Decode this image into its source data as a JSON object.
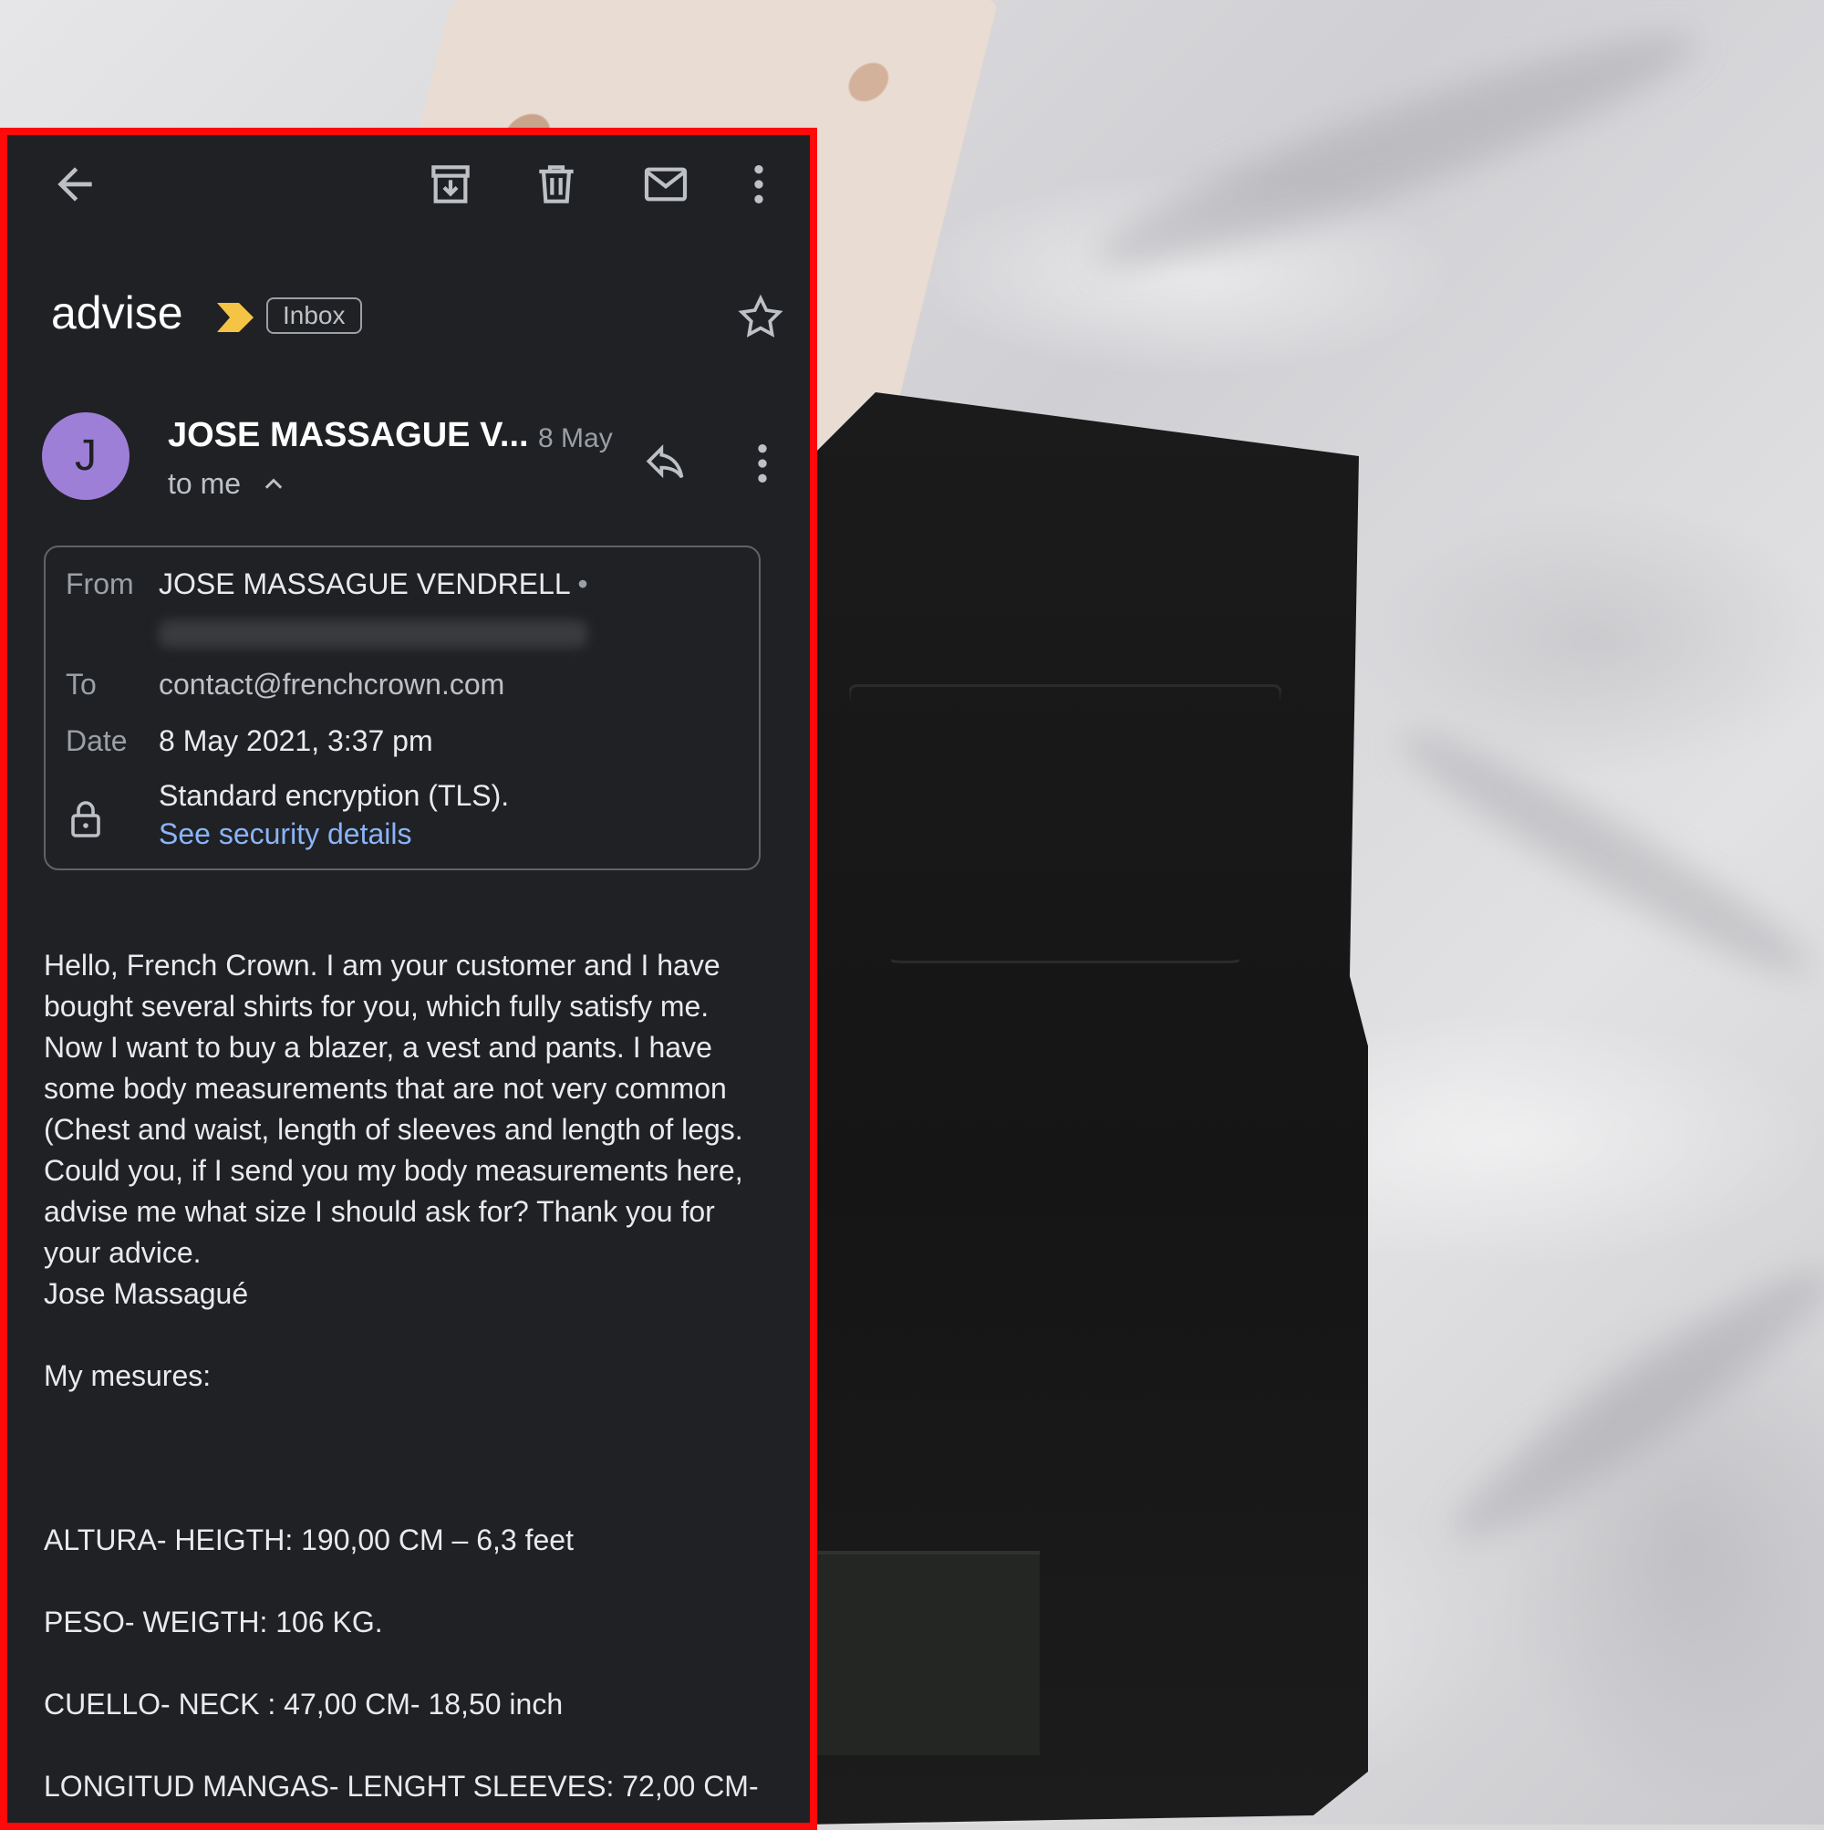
{
  "toolbar": {
    "icons": [
      "back-arrow-icon",
      "archive-icon",
      "delete-icon",
      "mark-unread-icon",
      "more-vert-icon"
    ]
  },
  "email": {
    "subject": "advise",
    "label": "Inbox",
    "sender_short": "JOSE MASSAGUE V...",
    "avatar_letter": "J",
    "date_short": "8 May",
    "to_me": "to me",
    "details": {
      "from_label": "From",
      "from_value": "JOSE MASSAGUE VENDRELL",
      "to_label": "To",
      "to_value": "contact@frenchcrown.com",
      "date_label": "Date",
      "date_value": "8 May 2021, 3:37 pm",
      "encryption": "Standard encryption (TLS).",
      "security_link": "See security details"
    },
    "body": [
      "Hello, French Crown. I am your customer and I have",
      "bought several shirts for you, which fully satisfy me.",
      "Now I want to buy a blazer, a vest and pants. I have",
      "some body measurements that are not very common",
      "(Chest and waist, length of sleeves and length of legs.",
      "Could you, if I send you my body measurements here,",
      "advise me what size I should ask for? Thank you for",
      "your advice.",
      "Jose Massagué"
    ],
    "measures_title": "My mesures:",
    "measures": [
      "ALTURA- HEIGTH: 190,00 CM – 6,3 feet",
      "PESO- WEIGTH: 106 KG.",
      "CUELLO- NECK : 47,00 CM- 18,50 inch",
      "LONGITUD MANGAS- LENGHT SLEEVES: 72,00 CM-"
    ]
  },
  "colors": {
    "frame": "#ff0a0a",
    "panel_bg": "#202124",
    "avatar": "#9e7fd8",
    "important_marker": "#f6c444",
    "link": "#8ab4f8"
  }
}
